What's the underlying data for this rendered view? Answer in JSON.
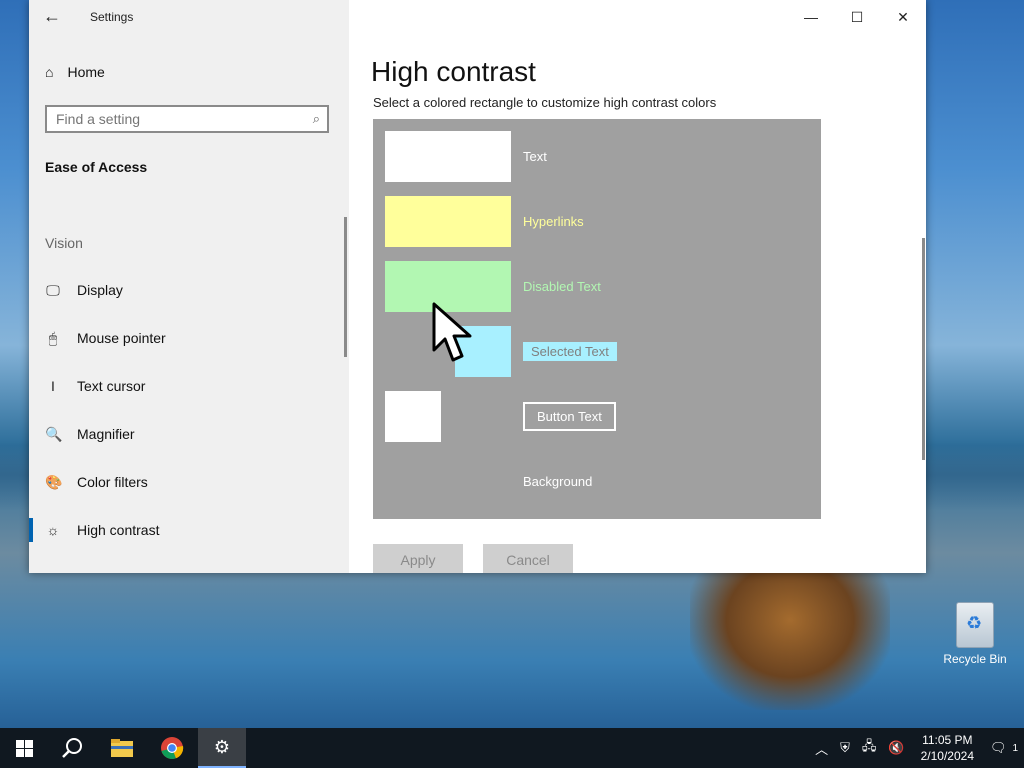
{
  "window": {
    "title": "Settings",
    "back_icon": "arrow-left-icon",
    "controls": {
      "minimize": "—",
      "maximize": "☐",
      "close": "✕"
    }
  },
  "sidebar": {
    "home_label": "Home",
    "search_placeholder": "Find a setting",
    "section_title": "Ease of Access",
    "group_label": "Vision",
    "items": [
      {
        "label": "Display",
        "icon": "monitor-icon",
        "glyph": "🖵"
      },
      {
        "label": "Mouse pointer",
        "icon": "mouse-pointer-icon",
        "glyph": "🖱"
      },
      {
        "label": "Text cursor",
        "icon": "text-cursor-icon",
        "glyph": "I"
      },
      {
        "label": "Magnifier",
        "icon": "magnifier-icon",
        "glyph": "🔍"
      },
      {
        "label": "Color filters",
        "icon": "palette-icon",
        "glyph": "🎨"
      },
      {
        "label": "High contrast",
        "icon": "sun-icon",
        "glyph": "☼"
      }
    ],
    "active_index": 5
  },
  "content": {
    "title": "High contrast",
    "subtitle": "Select a colored rectangle to customize high contrast colors",
    "preview": {
      "background_color": "#a0a0a0",
      "items": [
        {
          "label": "Text",
          "color": "#ffffff"
        },
        {
          "label": "Hyperlinks",
          "color": "#ffff9b"
        },
        {
          "label": "Disabled Text",
          "color": "#b2f7b2"
        },
        {
          "label": "Selected Text",
          "color": "#a8f0ff"
        },
        {
          "label": "Button Text",
          "color": "#ffffff"
        },
        {
          "label": "Background",
          "color": "#a0a0a0"
        }
      ]
    },
    "apply_label": "Apply",
    "cancel_label": "Cancel"
  },
  "desktop": {
    "recycle_bin_label": "Recycle Bin"
  },
  "taskbar": {
    "time": "11:05 PM",
    "date": "2/10/2024",
    "notification_count": "1"
  }
}
